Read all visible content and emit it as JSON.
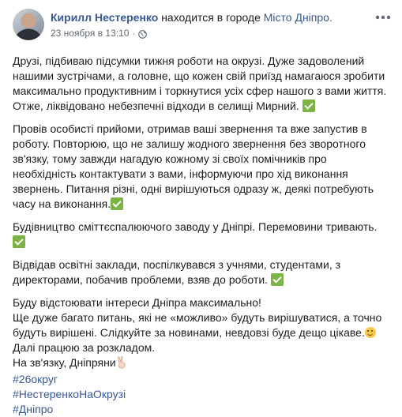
{
  "post": {
    "author": "Кирилл Нестеренко",
    "location_prefix": "находится в городе",
    "location": "Місто Дніпро.",
    "timestamp": "23 ноября в 13:10",
    "separator": "·",
    "privacy_icon": "globe-icon",
    "more_icon": "more-options-icon"
  },
  "paragraphs": [
    {
      "text": "Друзі, підбиваю підсумки тижня роботи на окрузі. Дуже задоволений нашими зустрічами, а головне, що кожен свій приїзд намагаюся зробити максимально продуктивним і торкнутися усіх сфер нашого з вами життя. Отже, ліквідовано небезпечні відходи в селищі Мирний.",
      "emoji": "check-mark-icon"
    },
    {
      "text": "Провів особисті прийоми, отримав ваші звернення та вже запустив в роботу. Повторюю, що не залишу жодного звернення без зворотного зв'язку, тому завжди нагадую кожному зі своїх помічників про необхідність контактувати з вами, інформуючи про хід виконання звернень. Питання різні, одні вирішуються одразу ж, деякі потребують часу на виконання.",
      "emoji": "check-mark-icon"
    },
    {
      "text": "Будівництво сміттєспалюючого заводу у Дніпрі. Перемовини тривають.",
      "emoji": "check-mark-icon"
    },
    {
      "text": "Відвідав освітні заклади, поспілкувався з учнями, студентами, з директорами, побачив проблеми, взяв до роботи.",
      "emoji": "check-mark-icon"
    }
  ],
  "closing": {
    "line1": "Буду відстоювати інтереси Дніпра максимально!",
    "line2": "Ще дуже багато питань, які не «можливо» будуть вирішуватися, а точно будуть вирішені. Слідкуйте за новинами, невдовзі буде дещо цікаве.",
    "line2_emoji": "winking-face-icon",
    "line3": "Далі працюю за розкладом.",
    "line4": "На зв'язку, Дніпряни",
    "line4_emoji": "victory-hand-icon"
  },
  "hashtags": [
    "#26округ",
    "#НестеренкоНаОкрузі",
    "#Дніпро"
  ],
  "colors": {
    "link": "#385898",
    "text": "#1c1e21",
    "meta": "#616770",
    "check": "#7bb344"
  }
}
